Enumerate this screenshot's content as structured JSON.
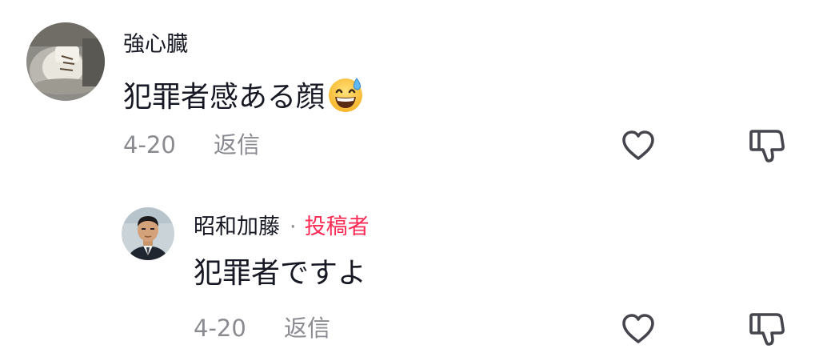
{
  "comments": [
    {
      "username": "強心臓",
      "text": "犯罪者感ある顔",
      "emoji": "grinning-face-with-sweat",
      "date": "4-20",
      "reply_label": "返信",
      "icons": {
        "like": "heart-icon",
        "dislike": "thumbs-down-icon"
      }
    },
    {
      "username": "昭和加藤",
      "separator": "·",
      "author_tag": "投稿者",
      "text": "犯罪者ですよ",
      "date": "4-20",
      "reply_label": "返信",
      "icons": {
        "like": "heart-icon",
        "dislike": "thumbs-down-icon"
      }
    }
  ],
  "colors": {
    "author_tag": "#fe2c55",
    "secondary_text": "#8a8b91",
    "primary_text": "#161823",
    "icon_stroke": "#45464d"
  }
}
